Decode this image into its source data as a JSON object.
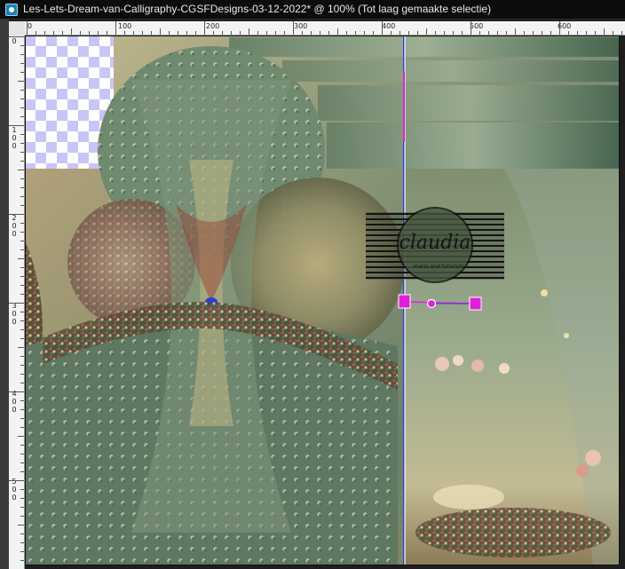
{
  "window": {
    "title": "Les-Lets-Dream-van-Calligraphy-CGSFDesigns-03-12-2022* @ 100% (Tot laag gemaakte selectie)"
  },
  "rulers": {
    "horizontal": [
      "0",
      "100",
      "200",
      "300",
      "400",
      "500",
      "600"
    ],
    "vertical": [
      "0",
      "1 0 0",
      "2 0 0",
      "3 0 0",
      "4 0 0",
      "5 0 0"
    ]
  },
  "watermark": {
    "name": "claudia",
    "tagline": "maria and tutorials"
  },
  "colors": {
    "title_bar": "#0c0c0c",
    "ruler": "#f3f3f3",
    "transparency_checker": "#c7c6f6",
    "selection_handle": "#e020d8",
    "guide_line": "#2b3ed6"
  }
}
